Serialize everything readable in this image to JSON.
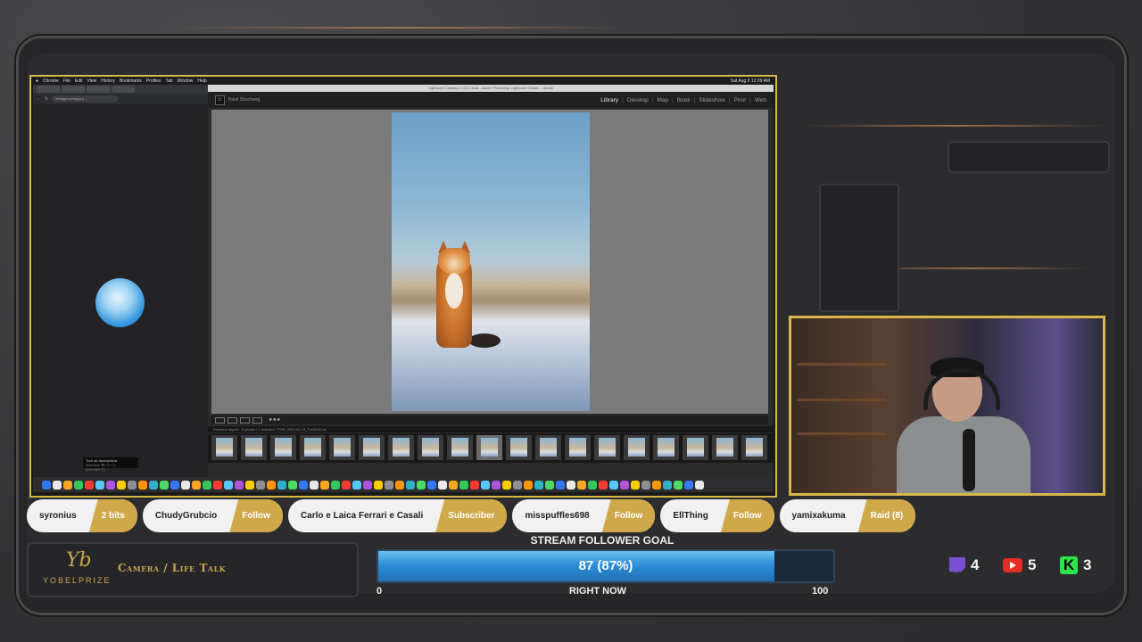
{
  "mac": {
    "menu": [
      "Chrome",
      "File",
      "Edit",
      "View",
      "History",
      "Bookmarks",
      "Profiles",
      "Tab",
      "Window",
      "Help"
    ],
    "clock": "Sat Aug 9  12:09 AM"
  },
  "chrome": {
    "url": "chatgpt.com/g/g-p...",
    "tooltip": "Turn on microphone",
    "tooltip_sub": "Shortcut: ⌘+⇧+⌥ (Ctrl+Alt+⇧)"
  },
  "lightroom": {
    "title": "Lightroom Catalog-2-v13-3.lrcat - Adobe Photoshop Lightroom Classic - Library",
    "identity": "Yobel Shucheng",
    "modules": [
      "Library",
      "Develop",
      "Map",
      "Book",
      "Slideshow",
      "Print",
      "Web"
    ],
    "active_module": "Library",
    "filmstrip_path": "Previous Import · 6 photos / 1 selected / PGR_2025-04-19_Fox0040.raf",
    "stars": "★★★",
    "thumb_count": 19,
    "selected_thumb": 9
  },
  "alerts": [
    {
      "name": "syronius",
      "badge": "2 bits"
    },
    {
      "name": "ChudyGrubcio",
      "badge": "Follow"
    },
    {
      "name": "Carlo e Laica Ferrari e Casali",
      "badge": "Subscriber"
    },
    {
      "name": "misspuffles698",
      "badge": "Follow"
    },
    {
      "name": "EllThing",
      "badge": "Follow"
    },
    {
      "name": "yamixakuma",
      "badge": "Raid (8)"
    }
  ],
  "brand": {
    "wordmark": "YOBELPRIZE",
    "subtitle": "Camera / Life Talk"
  },
  "goal": {
    "label": "STREAM FOLLOWER GOAL",
    "value_text": "87 (87%)",
    "fraction": 0.87,
    "min": "0",
    "max": "100",
    "now": "RIGHT NOW"
  },
  "social": {
    "twitch": "4",
    "youtube": "5",
    "kick": "3"
  },
  "colors": {
    "accent_gold": "#d9b64a",
    "goal_blue": "#2b8ad3"
  }
}
